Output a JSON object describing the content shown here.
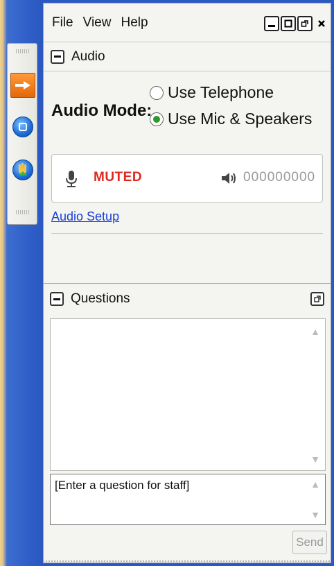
{
  "menu": {
    "file": "File",
    "view": "View",
    "help": "Help"
  },
  "window_buttons": [
    "minimize-icon",
    "maximize-icon",
    "restore-icon",
    "close-icon"
  ],
  "audio": {
    "section_title": "Audio",
    "mode_label": "Audio Mode:",
    "options": [
      {
        "label": "Use Telephone",
        "selected": false
      },
      {
        "label": "Use Mic & Speakers",
        "selected": true
      }
    ],
    "mic_status": "MUTED",
    "mic_status_color": "#e0281e",
    "volume_display": "000000000",
    "setup_link": "Audio Setup"
  },
  "questions": {
    "section_title": "Questions",
    "input_value": "[Enter a question for staff]",
    "send_label": "Send"
  },
  "toolbar_icons": [
    "arrow-right-icon",
    "stop-square-icon",
    "raise-hand-icon"
  ],
  "colors": {
    "accent_orange": "#e2680a",
    "link_blue": "#1a3fd6",
    "selected_radio": "#2a9a2a"
  }
}
